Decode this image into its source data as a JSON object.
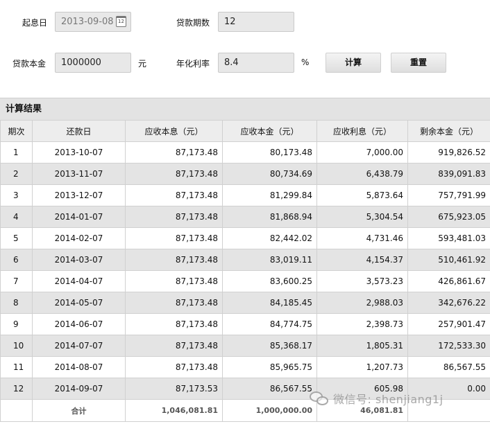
{
  "form": {
    "start_date_label": "起息日",
    "start_date_value": "2013-09-08",
    "calendar_icon_text": "12",
    "term_label": "贷款期数",
    "term_value": "12",
    "principal_label": "贷款本金",
    "principal_value": "1000000",
    "principal_unit": "元",
    "rate_label": "年化利率",
    "rate_value": "8.4",
    "rate_unit": "%",
    "calculate_label": "计算",
    "reset_label": "重置"
  },
  "result": {
    "title": "计算结果",
    "headers": [
      "期次",
      "还款日",
      "应收本息（元）",
      "应收本金（元）",
      "应收利息（元）",
      "剩余本金（元）"
    ],
    "rows": [
      {
        "idx": "1",
        "date": "2013-10-07",
        "total": "87,173.48",
        "principal": "80,173.48",
        "interest": "7,000.00",
        "remaining": "919,826.52"
      },
      {
        "idx": "2",
        "date": "2013-11-07",
        "total": "87,173.48",
        "principal": "80,734.69",
        "interest": "6,438.79",
        "remaining": "839,091.83"
      },
      {
        "idx": "3",
        "date": "2013-12-07",
        "total": "87,173.48",
        "principal": "81,299.84",
        "interest": "5,873.64",
        "remaining": "757,791.99"
      },
      {
        "idx": "4",
        "date": "2014-01-07",
        "total": "87,173.48",
        "principal": "81,868.94",
        "interest": "5,304.54",
        "remaining": "675,923.05"
      },
      {
        "idx": "5",
        "date": "2014-02-07",
        "total": "87,173.48",
        "principal": "82,442.02",
        "interest": "4,731.46",
        "remaining": "593,481.03"
      },
      {
        "idx": "6",
        "date": "2014-03-07",
        "total": "87,173.48",
        "principal": "83,019.11",
        "interest": "4,154.37",
        "remaining": "510,461.92"
      },
      {
        "idx": "7",
        "date": "2014-04-07",
        "total": "87,173.48",
        "principal": "83,600.25",
        "interest": "3,573.23",
        "remaining": "426,861.67"
      },
      {
        "idx": "8",
        "date": "2014-05-07",
        "total": "87,173.48",
        "principal": "84,185.45",
        "interest": "2,988.03",
        "remaining": "342,676.22"
      },
      {
        "idx": "9",
        "date": "2014-06-07",
        "total": "87,173.48",
        "principal": "84,774.75",
        "interest": "2,398.73",
        "remaining": "257,901.47"
      },
      {
        "idx": "10",
        "date": "2014-07-07",
        "total": "87,173.48",
        "principal": "85,368.17",
        "interest": "1,805.31",
        "remaining": "172,533.30"
      },
      {
        "idx": "11",
        "date": "2014-08-07",
        "total": "87,173.48",
        "principal": "85,965.75",
        "interest": "1,207.73",
        "remaining": "86,567.55"
      },
      {
        "idx": "12",
        "date": "2014-09-07",
        "total": "87,173.53",
        "principal": "86,567.55",
        "interest": "605.98",
        "remaining": "0.00"
      }
    ],
    "totals": {
      "label": "合计",
      "total": "1,046,081.81",
      "principal": "1,000,000.00",
      "interest": "46,081.81"
    }
  },
  "watermark": {
    "text": "微信号: shenjiang1j"
  }
}
